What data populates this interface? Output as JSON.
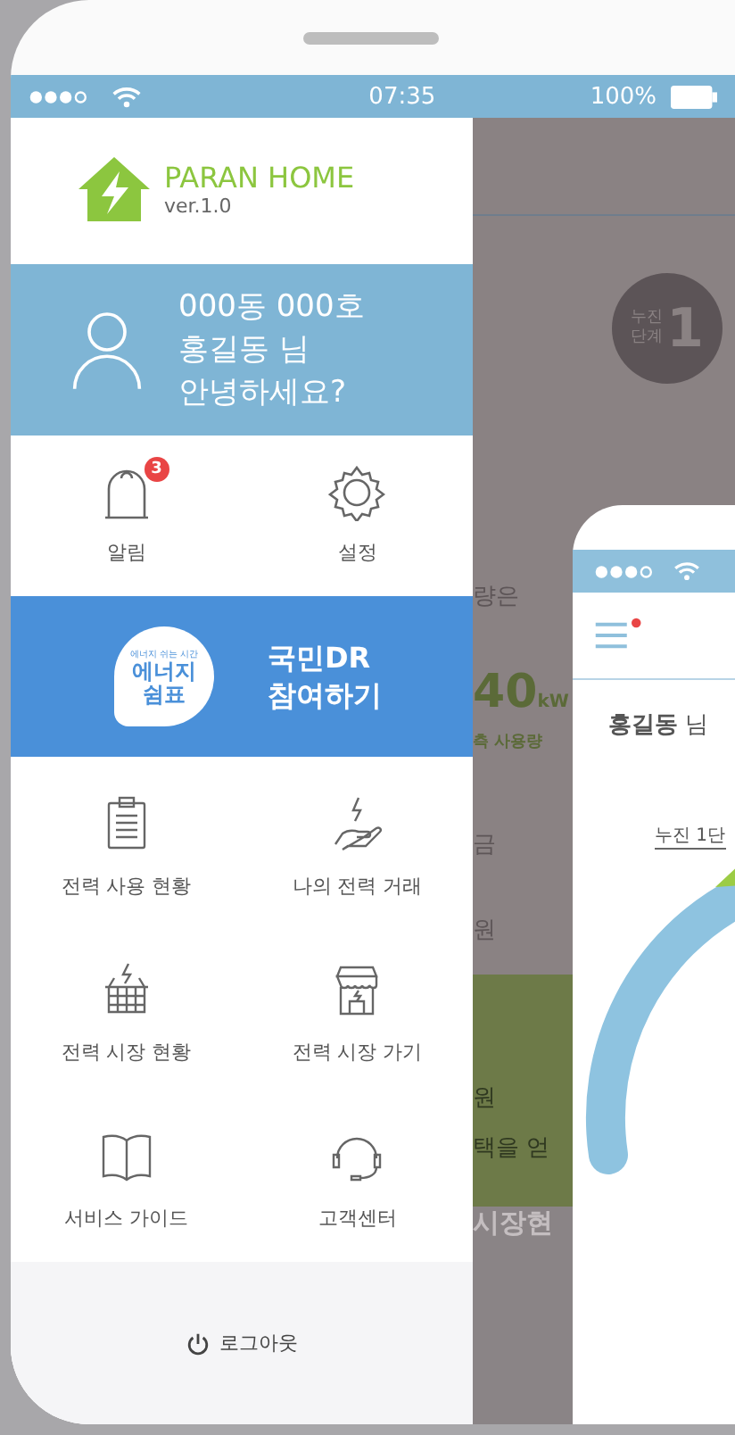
{
  "status_bar": {
    "time": "07:35",
    "battery": "100%"
  },
  "drawer": {
    "app_name": "PARAN HOME",
    "version": "ver.1.0",
    "profile_lines": [
      "000동 000호",
      "홍길동 님",
      "안녕하세요?"
    ],
    "quick_actions": [
      {
        "kind": "bell",
        "label": "알림",
        "badge": "3"
      },
      {
        "kind": "gear",
        "label": "설정"
      }
    ],
    "dr_banner": {
      "bubble_caption": "에너지 쉬는 시간",
      "bubble_lines": [
        "에너지",
        "쉼표"
      ],
      "title_lines": [
        "국민DR",
        "참여하기"
      ]
    },
    "menu": [
      {
        "kind": "clipboard",
        "label": "전력 사용 현황"
      },
      {
        "kind": "hand",
        "label": "나의 전력 거래"
      },
      {
        "kind": "basket",
        "label": "전력 시장 현황"
      },
      {
        "kind": "store",
        "label": "전력 시장 가기"
      },
      {
        "kind": "book",
        "label": "서비스 가이드"
      },
      {
        "kind": "headset",
        "label": "고객센터"
      }
    ],
    "logout": "로그아웃"
  },
  "background_screen": {
    "stage_badge": {
      "lines": [
        "누진",
        "단계"
      ],
      "number": "1"
    },
    "usage_label": "량은",
    "usage_value": "40",
    "usage_unit": "kW",
    "usage_caption": "측 사용량",
    "fee_label": "금",
    "fee_unit": "원",
    "green_unit": "원",
    "green_text": "택을 얻",
    "bottom_text": "시장현"
  },
  "second_phone": {
    "user": "**홍길동** 님",
    "stage_tab": "누진 1단"
  }
}
